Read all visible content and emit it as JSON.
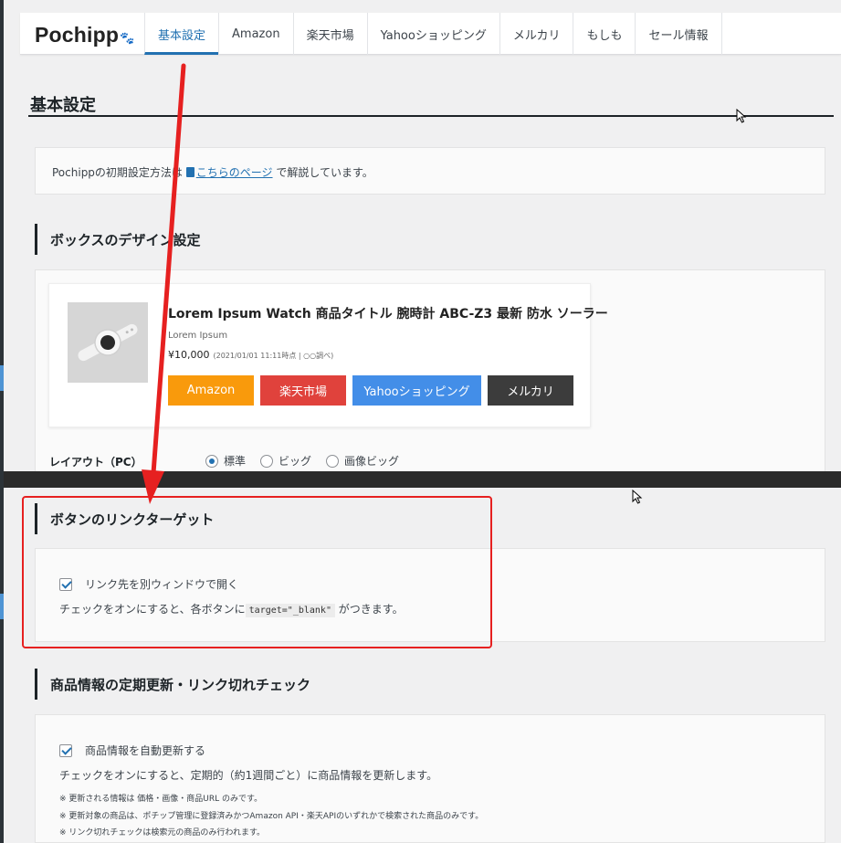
{
  "brand": {
    "name": "Pochipp",
    "paw_glyph": "🐾"
  },
  "nav": {
    "tabs": [
      {
        "label": "基本設定",
        "active": true
      },
      {
        "label": "Amazon",
        "active": false
      },
      {
        "label": "楽天市場",
        "active": false
      },
      {
        "label": "Yahooショッピング",
        "active": false
      },
      {
        "label": "メルカリ",
        "active": false
      },
      {
        "label": "もしも",
        "active": false
      },
      {
        "label": "セール情報",
        "active": false
      }
    ]
  },
  "page": {
    "title": "基本設定"
  },
  "intro": {
    "prefix": "Pochippの初期設定方法は",
    "link_text": "こちらのページ",
    "suffix": "で解説しています。"
  },
  "design_section": {
    "heading": "ボックスのデザイン設定",
    "preview": {
      "title": "Lorem Ipsum Watch 商品タイトル 腕時計 ABC-Z3 最新 防水 ソーラー",
      "brand": "Lorem Ipsum",
      "price": "¥10,000",
      "price_note": "(2021/01/01 11:11時点 | ○○調べ)",
      "buttons": [
        {
          "label": "Amazon",
          "color": "#f99a0c"
        },
        {
          "label": "楽天市場",
          "color": "#e0423c"
        },
        {
          "label": "Yahooショッピング",
          "color": "#438ee8"
        },
        {
          "label": "メルカリ",
          "color": "#3c3c3c"
        }
      ]
    },
    "layout_label": "レイアウト（PC）",
    "layout_options": [
      {
        "label": "標準",
        "selected": true
      },
      {
        "label": "ビッグ",
        "selected": false
      },
      {
        "label": "画像ビッグ",
        "selected": false
      }
    ]
  },
  "link_target_section": {
    "heading": "ボタンのリンクターゲット",
    "checkbox_label": "リンク先を別ウィンドウで開く",
    "checked": true,
    "desc_prefix": "チェックをオンにすると、各ボタンに",
    "code": "target=\"_blank\"",
    "desc_suffix": "がつきます。"
  },
  "update_section": {
    "heading": "商品情報の定期更新・リンク切れチェック",
    "checkbox_label": "商品情報を自動更新する",
    "checked": true,
    "description": "チェックをオンにすると、定期的（約1週間ごと）に商品情報を更新します。",
    "notes": [
      "※ 更新される情報は 価格・画像・商品URL のみです。",
      "※ 更新対象の商品は、ポチップ管理に登録済みかつAmazon API・楽天APIのいずれかで検索された商品のみです。",
      "※ リンク切れチェックは検索元の商品のみ行われます。"
    ]
  },
  "colors": {
    "accent": "#2271b1",
    "annotation_red": "#e62020",
    "checkbox_blue": "#2271b1"
  }
}
